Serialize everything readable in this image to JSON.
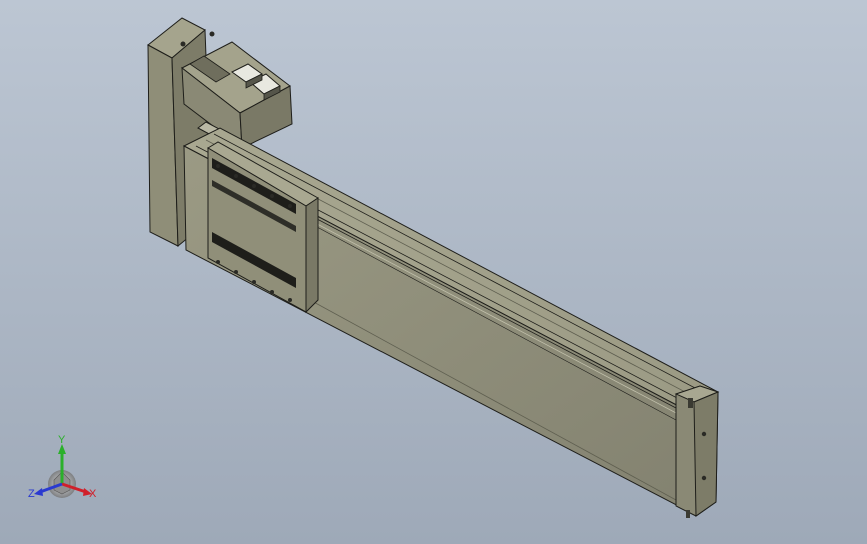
{
  "viewport": {
    "background_top": "#bcc6d3",
    "background_bottom": "#9ea9b8"
  },
  "model": {
    "body_color": "#8c8c77",
    "body_light": "#a6a58f",
    "body_dark": "#5f5f50",
    "edge_color": "#1e1e1a",
    "hole_color": "#2a2a25",
    "highlight": "#e8e8e0"
  },
  "triad": {
    "x_label": "X",
    "y_label": "Y",
    "z_label": "Z",
    "x_color": "#d0202a",
    "y_color": "#2bb02b",
    "z_color": "#2a3ad0"
  }
}
